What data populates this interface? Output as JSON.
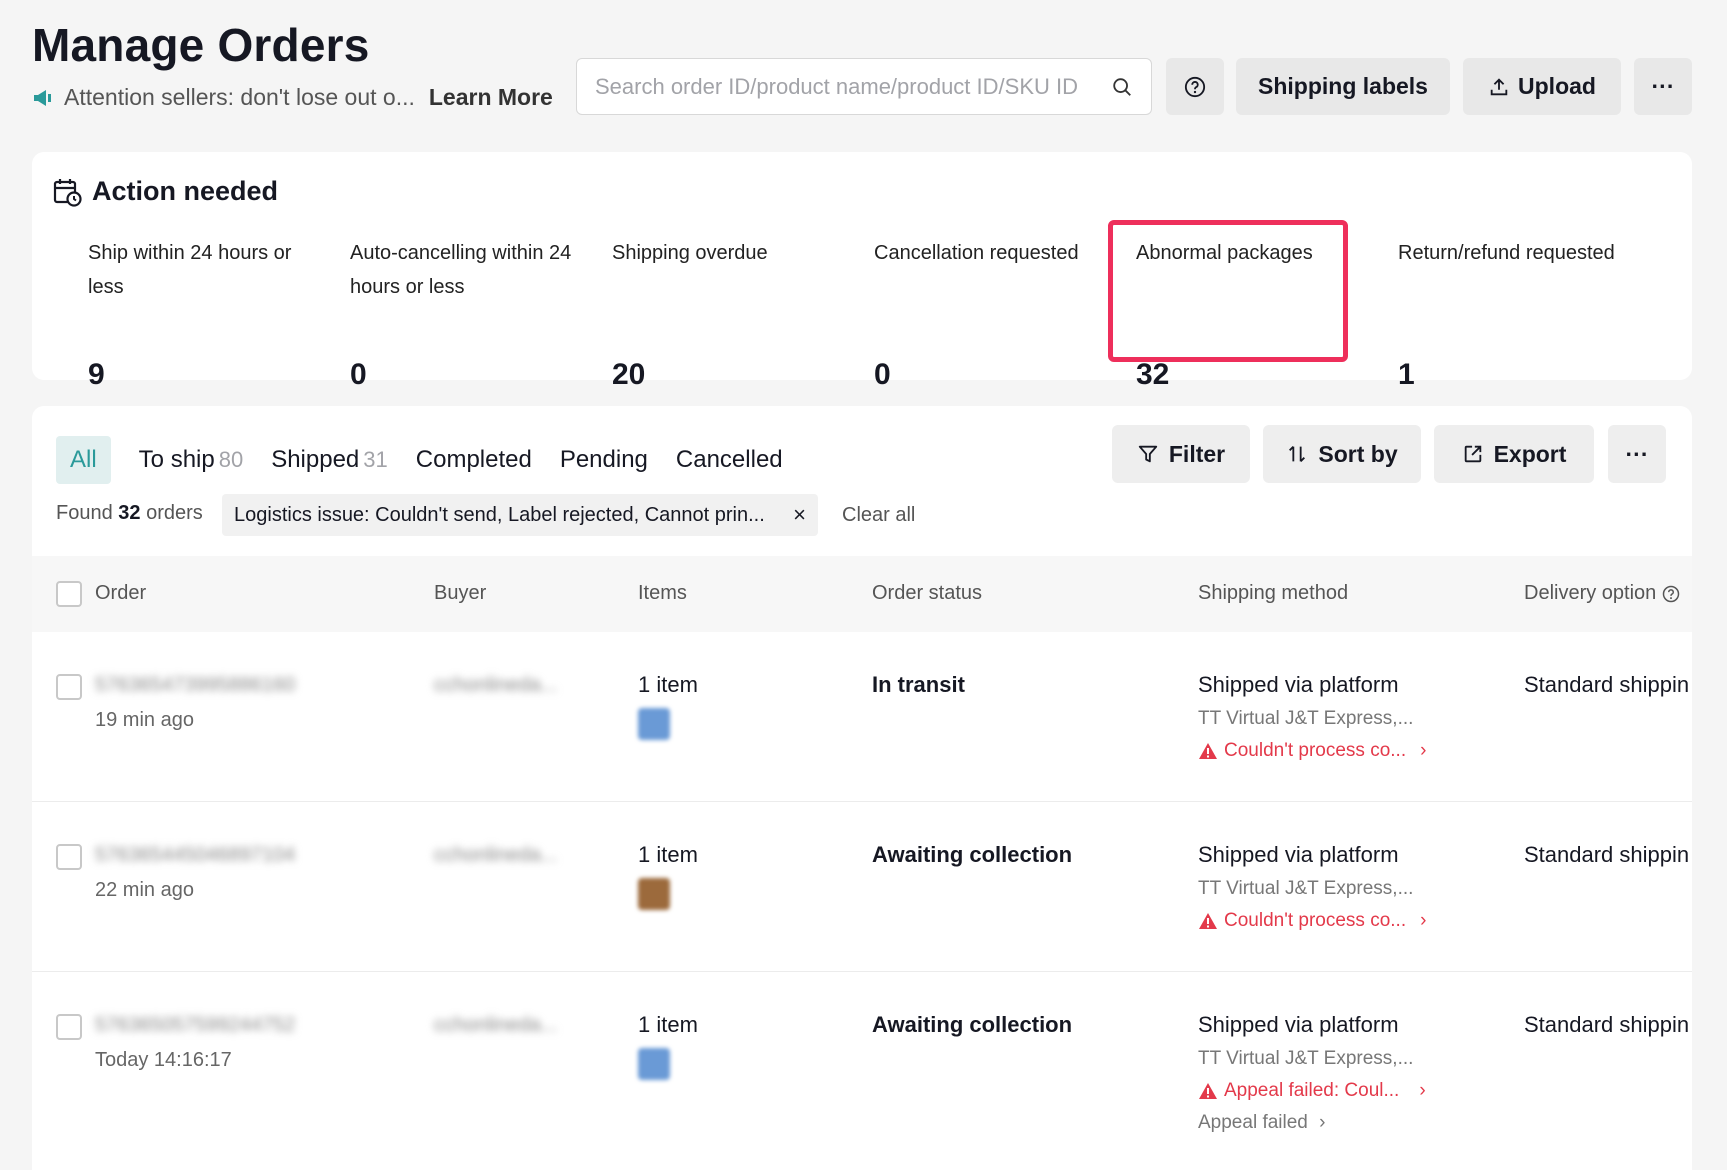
{
  "header": {
    "title": "Manage Orders",
    "notice": "Attention sellers: don't lose out o...",
    "learn_more": "Learn More",
    "search_placeholder": "Search order ID/product name/product ID/SKU ID",
    "shipping_labels": "Shipping labels",
    "upload": "Upload",
    "more": "···"
  },
  "action_needed": {
    "title": "Action needed",
    "metrics": [
      {
        "label": "Ship within 24 hours or less",
        "value": "9"
      },
      {
        "label": "Auto-cancelling within 24 hours or less",
        "value": "0"
      },
      {
        "label": "Shipping overdue",
        "value": "20"
      },
      {
        "label": "Cancellation requested",
        "value": "0"
      },
      {
        "label": "Abnormal packages",
        "value": "32"
      },
      {
        "label": "Return/refund requested",
        "value": "1"
      }
    ]
  },
  "orders": {
    "tabs": [
      {
        "label": "All",
        "count": ""
      },
      {
        "label": "To ship",
        "count": "80"
      },
      {
        "label": "Shipped",
        "count": "31"
      },
      {
        "label": "Completed",
        "count": ""
      },
      {
        "label": "Pending",
        "count": ""
      },
      {
        "label": "Cancelled",
        "count": ""
      }
    ],
    "filter": "Filter",
    "sort_by": "Sort by",
    "export": "Export",
    "more": "···",
    "found_prefix": "Found",
    "found_count": "32",
    "found_suffix": "orders",
    "chip": "Logistics issue:  Couldn't send, Label rejected, Cannot prin...",
    "chip_close": "×",
    "clear_all": "Clear all",
    "columns": {
      "order": "Order",
      "buyer": "Buyer",
      "items": "Items",
      "status": "Order status",
      "shipping": "Shipping method",
      "delivery": "Delivery option"
    },
    "rows": [
      {
        "order_id": "576365473995886160",
        "time": "19 min ago",
        "buyer": "cchonlineda...",
        "items": "1 item",
        "thumb_color": "#6a9ad6",
        "status": "In transit",
        "shipping": "Shipped via platform",
        "carrier": "TT Virtual J&T Express,...",
        "warning": "Couldn't process co...",
        "extra": "",
        "delivery": "Standard shippin"
      },
      {
        "order_id": "576365445046897104",
        "time": "22 min ago",
        "buyer": "cchonlineda...",
        "items": "1 item",
        "thumb_color": "#9c6a3c",
        "status": "Awaiting collection",
        "shipping": "Shipped via platform",
        "carrier": "TT Virtual J&T Express,...",
        "warning": "Couldn't process co...",
        "extra": "",
        "delivery": "Standard shippin"
      },
      {
        "order_id": "576365057599244752",
        "time": "Today 14:16:17",
        "buyer": "cchonlineda...",
        "items": "1 item",
        "thumb_color": "#6a9ad6",
        "status": "Awaiting collection",
        "shipping": "Shipped via platform",
        "carrier": "TT Virtual J&T Express,...",
        "warning": "Appeal failed: Coul...",
        "extra": "Appeal failed",
        "delivery": "Standard shippin"
      }
    ]
  }
}
